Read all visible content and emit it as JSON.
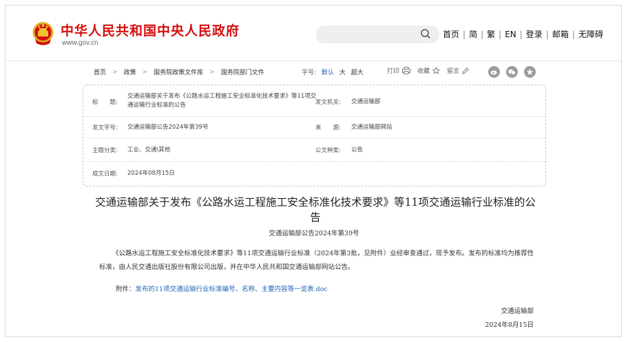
{
  "header": {
    "site_name": "中华人民共和国中央人民政府",
    "site_url": "www.gov.cn",
    "search_placeholder": "",
    "nav": [
      "首页",
      "简",
      "繁",
      "EN",
      "登录",
      "邮箱",
      "无障碍"
    ],
    "nav_separator": "|"
  },
  "breadcrumb": [
    "首页",
    "政策",
    "国务院政策文件库",
    "国务院部门文件"
  ],
  "font_size": {
    "label": "字号:",
    "options": [
      "默认",
      "大",
      "超大"
    ],
    "active": "默认"
  },
  "tools": {
    "print": "打印",
    "favorite": "收藏",
    "comment": "留言"
  },
  "share_icons": [
    "weibo-icon",
    "wechat-icon",
    "star-icon"
  ],
  "info": {
    "title_label": "标　　题:",
    "title_value": "交通运输部关于发布《公路水运工程施工安全标准化技术要求》等11项交通运输行业标准的公告",
    "issuer_label": "发文机关:",
    "issuer_value": "交通运输部",
    "docno_label": "发文字号:",
    "docno_value": "交通运输部公告2024年第39号",
    "source_label": "来　　源:",
    "source_value": "交通运输部网站",
    "topic_label": "主题分类:",
    "topic_value": "工业、交通\\其他",
    "type_label": "公文种类:",
    "type_value": "公告",
    "date_label": "成文日期:",
    "date_value": "2024年08月15日"
  },
  "article": {
    "title": "交通运输部关于发布《公路水运工程施工安全标准化技术要求》等11项交通运输行业标准的公告",
    "doc_no": "交通运输部公告2024年第39号",
    "body": "《公路水运工程施工安全标准化技术要求》等11项交通运输行业标准（2024年第3批，见附件）业经审查通过，现予发布。发布的标准均为推荐性标准，由人民交通出版社股份有限公司出版，并在中华人民共和国交通运输部网站公告。",
    "attachment_label": "附件：",
    "attachment_link": "发布的11项交通运输行业标准编号、名称、主要内容等一览表.doc",
    "signature": "交通运输部",
    "date": "2024年8月15日"
  },
  "colors": {
    "brand_red": "#d40e0e",
    "link_blue": "#1f63b8"
  }
}
